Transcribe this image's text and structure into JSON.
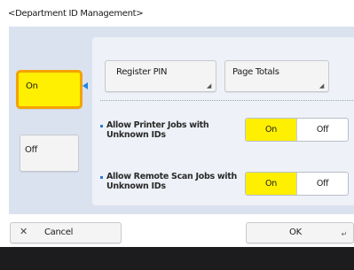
{
  "screen": {
    "title": "<Department ID Management>"
  },
  "mode": {
    "on_label": "On",
    "off_label": "Off",
    "selected": "On"
  },
  "actions": {
    "register_pin_label": "Register PIN",
    "page_totals_label": "Page Totals"
  },
  "settings": {
    "printer_jobs": {
      "label_line1": "Allow Printer Jobs with",
      "label_line2": "Unknown IDs",
      "on_label": "On",
      "off_label": "Off",
      "selected": "On"
    },
    "remote_scan": {
      "label_line1": "Allow Remote Scan Jobs with",
      "label_line2": "Unknown IDs",
      "on_label": "On",
      "off_label": "Off",
      "selected": "On"
    }
  },
  "footer": {
    "cancel_label": "Cancel",
    "ok_label": "OK"
  },
  "colors": {
    "selected_yellow": "#ffef00",
    "focus_orange": "#f4a300",
    "panel_blue": "#dbe2ef",
    "pointer_blue": "#1f86e6",
    "footer_dark": "#1c1c1e"
  },
  "icons": {
    "cancel": "close-icon",
    "ok": "enter-icon",
    "button_corner": "corner-arrow-icon"
  }
}
